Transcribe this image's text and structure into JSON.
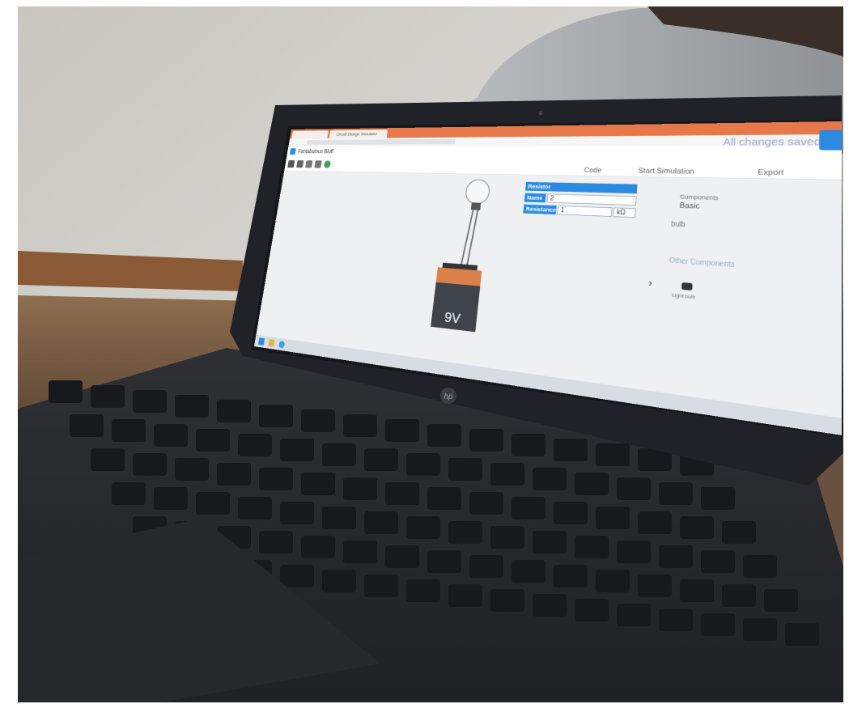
{
  "scene": {
    "description_free_labels": {
      "brand_logo": "hp"
    }
  },
  "browser": {
    "tabs": [
      {
        "label": ""
      },
      {
        "label": "Circuit Design Simulator"
      }
    ],
    "project_title": "Fantabulous Bluff"
  },
  "toolbar": {
    "status": "All changes saved",
    "code_label": "Code",
    "start_simulation_label": "Start Simulation",
    "export_label": "Export"
  },
  "inspector": {
    "header": "Resistor",
    "name_label": "Name",
    "name_value": "2",
    "resistance_label": "Resistance",
    "resistance_value": "1",
    "unit": "kΩ"
  },
  "components_panel": {
    "components_label": "Components",
    "components_value": "Basic",
    "search_value": "bulb",
    "other_label": "Other Components",
    "item_label": "Light bulb"
  },
  "canvas": {
    "battery_label": "9V"
  },
  "colors": {
    "accent": "#2c8be0",
    "browser_tabbar": "#e7784a",
    "battery_top": "#d9814a",
    "battery_body": "#3f434a"
  }
}
